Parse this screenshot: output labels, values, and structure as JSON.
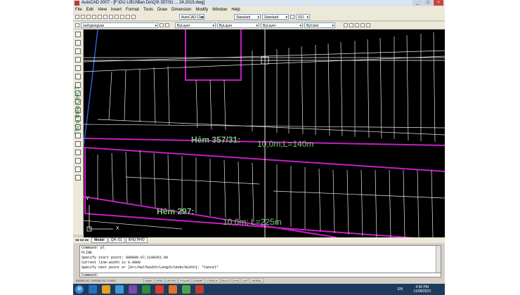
{
  "window": {
    "title": "AutoCAD 2007 - [F:\\DU LIEU\\Ban Do\\Q3\\ 357/31 ... 24.2015.dwg]",
    "controls": [
      "_",
      "□",
      "×"
    ]
  },
  "menu": [
    "File",
    "Edit",
    "View",
    "Insert",
    "Format",
    "Tools",
    "Draw",
    "Dimension",
    "Modify",
    "Window",
    "Help"
  ],
  "toolbar": {
    "workspace_value": "AutoCAD Classic",
    "textstyle_value": "Standard",
    "dimstyle_value": "Standard",
    "layer_value": "ranhgiongvan",
    "color_value": "ByLayer",
    "linetype_value": "ByLayer",
    "lineweight_value": "ByLayer",
    "plotstyle_value": "ByColor",
    "scale_value": "ISO"
  },
  "side_title": "Thửa theo QHCT",
  "drawing": {
    "street_label_1": "Hẻm 357/31:",
    "street_dims_1": "10,0m;L=140m",
    "street_label_2": "Hẻm 297:",
    "street_dims_2": "10,0m; L=225m",
    "axis_x": "X",
    "axis_y": "Y"
  },
  "layout_tabs": [
    "Model",
    "QH -01",
    "KHU PHO"
  ],
  "command_history": [
    "Command: pl",
    "PLINE",
    "Specify start point: 890008.97,1190261.00",
    "Current line-width is 0.0000",
    "Specify next point or [Arc/Halfwidth/Length/Undo/Width]: *Cancel*",
    "",
    "Command:"
  ],
  "command_prompt": "Command:",
  "coordinates": "586061.92, 1190262.92, 0.0000",
  "status_toggles": [
    "SNAP",
    "GRID",
    "ORTHO",
    "POLAR",
    "OSNAP",
    "OTRACK",
    "DUCS",
    "DYN",
    "LWT",
    "MODEL"
  ],
  "tray": {
    "language": "EN",
    "time": "4:30 PM",
    "date": "11/08/2023"
  },
  "colors": {
    "viewport": "#000000",
    "magenta": "#c21fc2",
    "street_text": "#7cc67c",
    "taskbar": "#1d3b5c"
  }
}
